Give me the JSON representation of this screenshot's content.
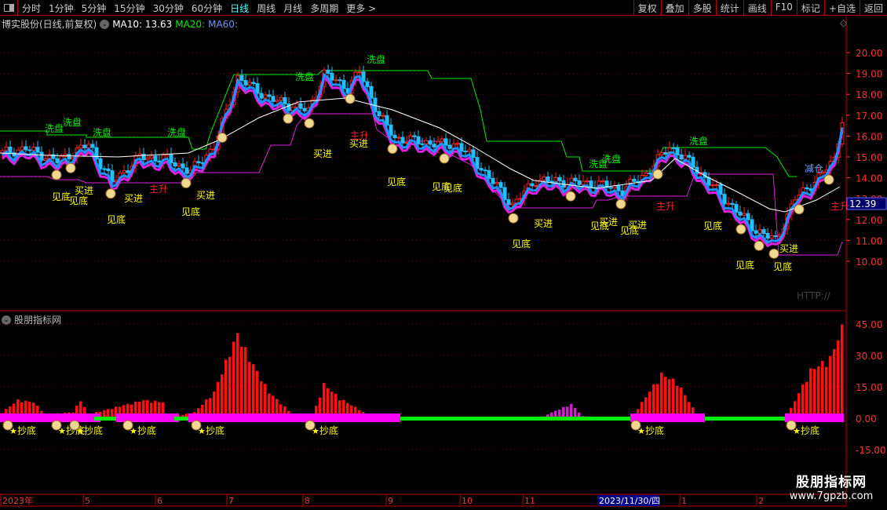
{
  "toolbar": {
    "periods": [
      "分时",
      "1分钟",
      "5分钟",
      "15分钟",
      "30分钟",
      "60分钟",
      "日线",
      "周线",
      "月线",
      "多周期",
      "更多 >"
    ],
    "active": "日线",
    "buttons": [
      "复权",
      "叠加",
      "多股",
      "统计",
      "画线",
      "F10",
      "标记",
      "+自选",
      "返回"
    ]
  },
  "header": {
    "title": "博实股份(日线,前复权)",
    "ma10": "MA10: 13.63",
    "ma20": "MA20:",
    "ma60": "MA60:"
  },
  "colors": {
    "up": "#ff2020",
    "down": "#20c0ff",
    "ma": "#ffffff",
    "wash_line": "#00ee00",
    "support_line": "#e020e0",
    "label_yellow": "#ffff00",
    "label_green": "#00ee00",
    "label_red": "#ff2020",
    "label_blue": "#6aa0ff",
    "axis": "#ff3030"
  },
  "price_axis": {
    "ticks": [
      "20.00",
      "19.00",
      "18.00",
      "17.00",
      "16.00",
      "15.00",
      "14.00",
      "13.00",
      "12.00",
      "11.00",
      "10.00"
    ],
    "current": "12.39",
    "watermark": "HTTP://"
  },
  "chart_data": {
    "type": "candlestick",
    "bars": 215,
    "close_keypoints": [
      [
        0,
        15.2
      ],
      [
        6,
        15.4
      ],
      [
        14,
        14.8
      ],
      [
        22,
        15.6
      ],
      [
        28,
        13.8
      ],
      [
        35,
        15.0
      ],
      [
        42,
        14.9
      ],
      [
        48,
        14.3
      ],
      [
        54,
        15.5
      ],
      [
        60,
        18.8
      ],
      [
        68,
        17.8
      ],
      [
        78,
        17.2
      ],
      [
        82,
        19.0
      ],
      [
        88,
        18.3
      ],
      [
        91,
        19.1
      ],
      [
        96,
        17.0
      ],
      [
        100,
        15.9
      ],
      [
        112,
        15.6
      ],
      [
        116,
        15.6
      ],
      [
        120,
        14.9
      ],
      [
        130,
        12.7
      ],
      [
        136,
        13.9
      ],
      [
        144,
        13.8
      ],
      [
        152,
        13.7
      ],
      [
        158,
        13.4
      ],
      [
        164,
        14.2
      ],
      [
        170,
        15.5
      ],
      [
        176,
        14.6
      ],
      [
        184,
        13.0
      ],
      [
        192,
        11.5
      ],
      [
        197,
        11.0
      ],
      [
        202,
        13.0
      ],
      [
        208,
        14.0
      ],
      [
        212,
        14.9
      ],
      [
        214,
        16.8
      ]
    ],
    "ylim": [
      9.0,
      21.0
    ]
  },
  "signals": {
    "wash": [
      "洗盘",
      "洗盘",
      "洗盘",
      "洗盘",
      "洗盘",
      "洗盘",
      "洗盘",
      "洗盘",
      "洗盘"
    ],
    "bottom": [
      "见底",
      "见底",
      "见底",
      "见底",
      "见底",
      "见底",
      "见底",
      "见底",
      "见底",
      "见底",
      "见底",
      "见底",
      "见底"
    ],
    "buy": [
      "买进",
      "买进",
      "买进",
      "买进",
      "买进",
      "买进",
      "买进",
      "买进",
      "买进"
    ],
    "rise": [
      "主升",
      "主升",
      "主升",
      "主升"
    ],
    "reduce": [
      "减仓"
    ]
  },
  "indicator": {
    "title": "股朋指标网",
    "ticks": [
      "45.00",
      "30.00",
      "15.00",
      "0.00",
      "-15.00"
    ],
    "ylim": [
      -20,
      48
    ],
    "hist_keypoints": [
      [
        0,
        3
      ],
      [
        4,
        9
      ],
      [
        8,
        8
      ],
      [
        11,
        2
      ],
      [
        18,
        3
      ],
      [
        20,
        9
      ],
      [
        22,
        2
      ],
      [
        32,
        7
      ],
      [
        36,
        9
      ],
      [
        41,
        8
      ],
      [
        42,
        0
      ],
      [
        49,
        3
      ],
      [
        54,
        13
      ],
      [
        58,
        33
      ],
      [
        60,
        42
      ],
      [
        63,
        30
      ],
      [
        68,
        13
      ],
      [
        74,
        2
      ],
      [
        79,
        0
      ],
      [
        80,
        6
      ],
      [
        82,
        17
      ],
      [
        86,
        10
      ],
      [
        93,
        2
      ],
      [
        94,
        0
      ],
      [
        138,
        0
      ],
      [
        139,
        2
      ],
      [
        145,
        7
      ],
      [
        148,
        1
      ],
      [
        161,
        0
      ],
      [
        162,
        5
      ],
      [
        168,
        22
      ],
      [
        172,
        18
      ],
      [
        177,
        2
      ],
      [
        178,
        0
      ],
      [
        200,
        0
      ],
      [
        201,
        5
      ],
      [
        206,
        24
      ],
      [
        211,
        30
      ],
      [
        214,
        45
      ]
    ],
    "signal_label": "抄底",
    "signal_count": 8
  },
  "time_axis": {
    "labels": [
      "2023年",
      "5",
      "6",
      "7",
      "8",
      "9",
      "10",
      "11",
      "2023/11/30/四",
      "1",
      "2"
    ]
  },
  "watermark": {
    "name": "股朋指标网",
    "url": "www.7gpzb.com"
  }
}
